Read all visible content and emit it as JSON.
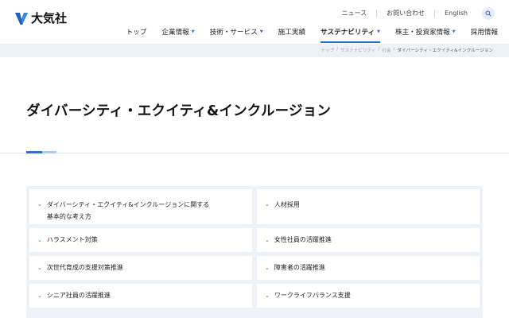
{
  "brand": {
    "name": "大気社",
    "accent_color": "#2c6fd0"
  },
  "util_nav": [
    "ニュース",
    "お問い合わせ",
    "English"
  ],
  "main_nav": [
    {
      "label": "トップ",
      "dropdown": false,
      "active": false
    },
    {
      "label": "企業情報",
      "dropdown": true,
      "active": false
    },
    {
      "label": "技術・サービス",
      "dropdown": true,
      "active": false
    },
    {
      "label": "施工実績",
      "dropdown": false,
      "active": false
    },
    {
      "label": "サステナビリティ",
      "dropdown": true,
      "active": true
    },
    {
      "label": "株主・投資家情報",
      "dropdown": true,
      "active": false
    },
    {
      "label": "採用情報",
      "dropdown": false,
      "active": false
    }
  ],
  "breadcrumb": [
    "トップ",
    "サステナビリティ",
    "社会",
    "ダイバーシティ・エクイティ&インクルージョン"
  ],
  "page_title": "ダイバーシティ・エクイティ&インクルージョン",
  "links": [
    {
      "line1": "ダイバーシティ・エクイティ&インクルージョンに関する",
      "line2": "基本的な考え方"
    },
    {
      "line1": "人材採用"
    },
    {
      "line1": "ハラスメント対策"
    },
    {
      "line1": "女性社員の活躍推進"
    },
    {
      "line1": "次世代育成の支援対策推進"
    },
    {
      "line1": "障害者の活躍推進"
    },
    {
      "line1": "シニア社員の活躍推進"
    },
    {
      "line1": "ワークライフバランス支援"
    }
  ],
  "icons": {
    "logo": "taikisha-logo-icon",
    "search": "search-icon",
    "caret": "caret-down-icon",
    "chevron": "chevron-down-icon"
  }
}
